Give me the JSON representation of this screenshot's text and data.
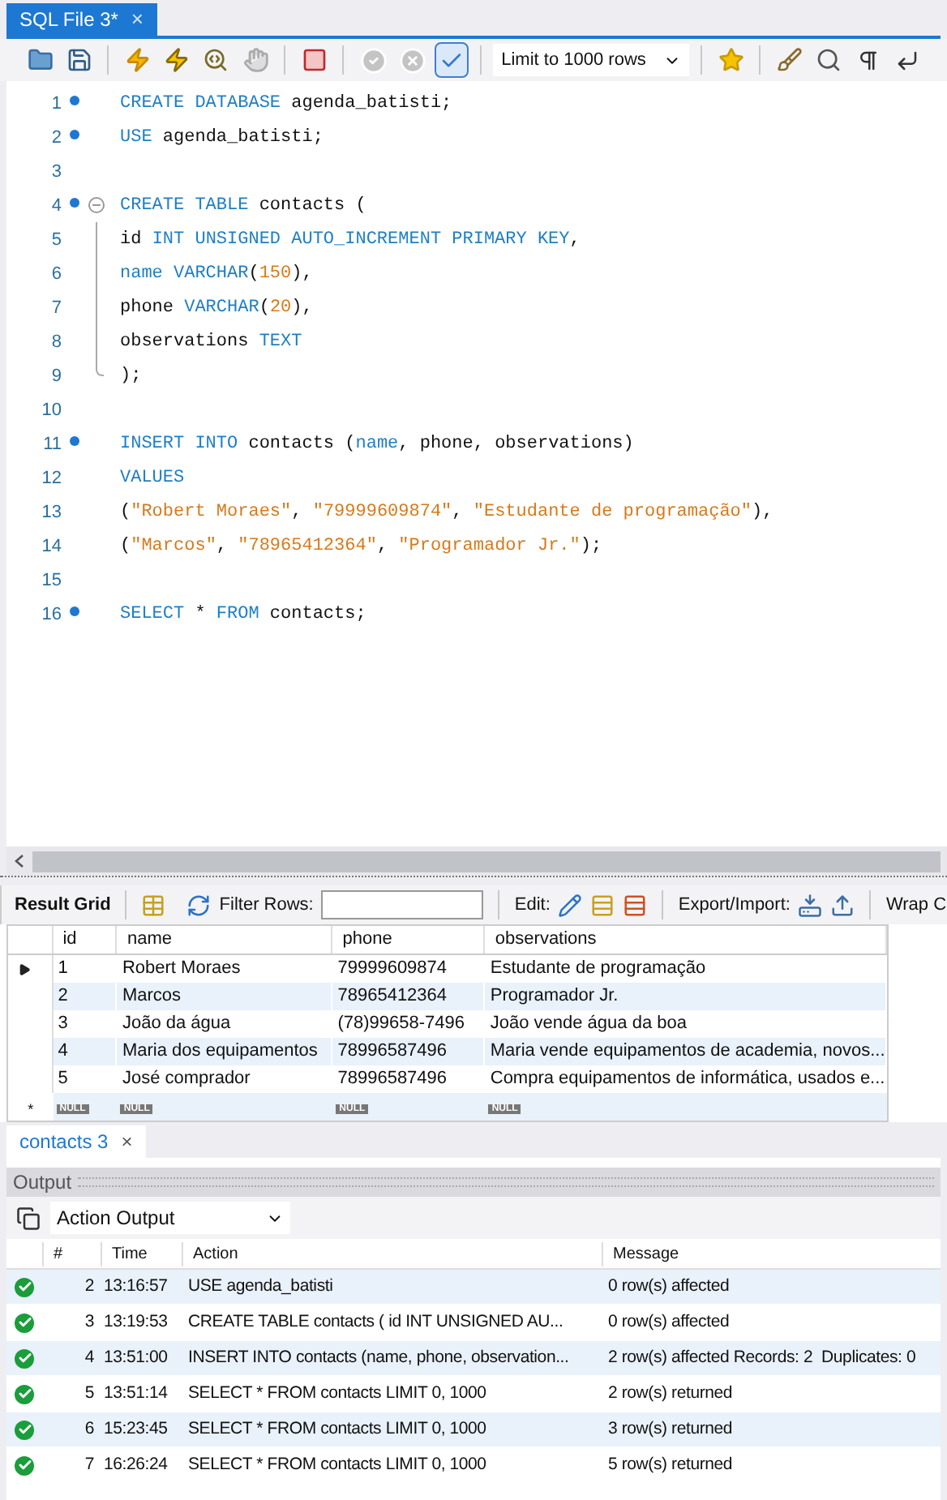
{
  "editor_tab": {
    "title": "SQL File 3*",
    "close": "×"
  },
  "toolbar": {
    "limit": "Limit to 1000 rows",
    "toggle_on": true
  },
  "code": [
    {
      "number": "1",
      "statement": true,
      "tokens": [
        {
          "kind": "kw",
          "text": "CREATE DATABASE"
        },
        {
          "kind": "plain",
          "text": " agenda_batisti;"
        }
      ]
    },
    {
      "number": "2",
      "statement": true,
      "tokens": [
        {
          "kind": "kw",
          "text": "USE"
        },
        {
          "kind": "plain",
          "text": " agenda_batisti;"
        }
      ]
    },
    {
      "number": "3",
      "statement": false
    },
    {
      "number": "4",
      "statement": true,
      "fold_start": true,
      "tokens": [
        {
          "kind": "kw",
          "text": "CREATE TABLE"
        },
        {
          "kind": "plain",
          "text": " contacts ("
        }
      ]
    },
    {
      "number": "5",
      "statement": false,
      "fold_body": true,
      "tokens": [
        {
          "kind": "plain",
          "text": "id "
        },
        {
          "kind": "kw",
          "text": "INT UNSIGNED AUTO_INCREMENT PRIMARY KEY"
        },
        {
          "kind": "plain",
          "text": ","
        }
      ]
    },
    {
      "number": "6",
      "statement": false,
      "fold_body": true,
      "tokens": [
        {
          "kind": "kw",
          "text": "name VARCHAR"
        },
        {
          "kind": "plain",
          "text": "("
        },
        {
          "kind": "lit",
          "text": "150"
        },
        {
          "kind": "plain",
          "text": "),"
        }
      ]
    },
    {
      "number": "7",
      "statement": false,
      "fold_body": true,
      "tokens": [
        {
          "kind": "plain",
          "text": "phone "
        },
        {
          "kind": "kw",
          "text": "VARCHAR"
        },
        {
          "kind": "plain",
          "text": "("
        },
        {
          "kind": "lit",
          "text": "20"
        },
        {
          "kind": "plain",
          "text": "),"
        }
      ]
    },
    {
      "number": "8",
      "statement": false,
      "fold_body": true,
      "tokens": [
        {
          "kind": "plain",
          "text": "observations "
        },
        {
          "kind": "kw",
          "text": "TEXT"
        }
      ]
    },
    {
      "number": "9",
      "statement": false,
      "fold_end": true,
      "tokens": [
        {
          "kind": "plain",
          "text": ");"
        }
      ]
    },
    {
      "number": "10",
      "statement": false
    },
    {
      "number": "11",
      "statement": true,
      "tokens": [
        {
          "kind": "kw",
          "text": "INSERT INTO"
        },
        {
          "kind": "plain",
          "text": " contacts ("
        },
        {
          "kind": "kw",
          "text": "name"
        },
        {
          "kind": "plain",
          "text": ", phone, observations)"
        }
      ]
    },
    {
      "number": "12",
      "statement": false,
      "tokens": [
        {
          "kind": "kw",
          "text": "VALUES"
        }
      ]
    },
    {
      "number": "13",
      "statement": false,
      "tokens": [
        {
          "kind": "plain",
          "text": "("
        },
        {
          "kind": "lit",
          "text": "\"Robert Moraes\""
        },
        {
          "kind": "plain",
          "text": ", "
        },
        {
          "kind": "lit",
          "text": "\"79999609874\""
        },
        {
          "kind": "plain",
          "text": ", "
        },
        {
          "kind": "lit",
          "text": "\"Estudante de programação\""
        },
        {
          "kind": "plain",
          "text": "),"
        }
      ]
    },
    {
      "number": "14",
      "statement": false,
      "tokens": [
        {
          "kind": "plain",
          "text": "("
        },
        {
          "kind": "lit",
          "text": "\"Marcos\""
        },
        {
          "kind": "plain",
          "text": ", "
        },
        {
          "kind": "lit",
          "text": "\"78965412364\""
        },
        {
          "kind": "plain",
          "text": ", "
        },
        {
          "kind": "lit",
          "text": "\"Programador Jr.\""
        },
        {
          "kind": "plain",
          "text": ");"
        }
      ]
    },
    {
      "number": "15",
      "statement": false
    },
    {
      "number": "16",
      "statement": true,
      "tokens": [
        {
          "kind": "kw",
          "text": "SELECT"
        },
        {
          "kind": "plain",
          "text": " * "
        },
        {
          "kind": "kw",
          "text": "FROM"
        },
        {
          "kind": "plain",
          "text": " contacts;"
        }
      ]
    }
  ],
  "result_toolbar": {
    "result_grid": "Result Grid",
    "filter_label": "Filter Rows:",
    "edit_label": "Edit:",
    "export_label": "Export/Import:",
    "wrap_label": "Wrap C"
  },
  "grid": {
    "columns": [
      "id",
      "name",
      "phone",
      "observations"
    ],
    "rows": [
      {
        "current": true,
        "cells": [
          "1",
          "Robert Moraes",
          "79999609874",
          "Estudante de programação"
        ]
      },
      {
        "current": false,
        "cells": [
          "2",
          "Marcos",
          "78965412364",
          "Programador Jr."
        ]
      },
      {
        "current": false,
        "cells": [
          "3",
          "João da água",
          "(78)99658-7496",
          "João vende água da boa"
        ]
      },
      {
        "current": false,
        "cells": [
          "4",
          "Maria dos equipamentos",
          "78996587496",
          "Maria vende equipamentos de academia, novos..."
        ]
      },
      {
        "current": false,
        "cells": [
          "5",
          "José comprador",
          "78996587496",
          "Compra equipamentos de informática, usados e..."
        ]
      }
    ],
    "new_row": {
      "marker": "*",
      "cells": [
        "NULL",
        "NULL",
        "NULL",
        "NULL"
      ]
    }
  },
  "result_tab": {
    "title": "contacts 3",
    "close": "×"
  },
  "output": {
    "title": "Output",
    "selector": "Action Output",
    "columns": [
      "#",
      "Time",
      "Action",
      "Message"
    ],
    "rows": [
      {
        "success": true,
        "number": "2",
        "time": "13:16:57",
        "action": "USE agenda_batisti",
        "message": "0 row(s) affected"
      },
      {
        "success": true,
        "number": "3",
        "time": "13:19:53",
        "action": "CREATE TABLE contacts ( id INT UNSIGNED AU...",
        "message": "0 row(s) affected"
      },
      {
        "success": true,
        "number": "4",
        "time": "13:51:00",
        "action": "INSERT INTO contacts (name, phone, observation...",
        "message": "2 row(s) affected Records: 2  Duplicates: 0"
      },
      {
        "success": true,
        "number": "5",
        "time": "13:51:14",
        "action": "SELECT * FROM contacts LIMIT 0, 1000",
        "message": "2 row(s) returned"
      },
      {
        "success": true,
        "number": "6",
        "time": "15:23:45",
        "action": "SELECT * FROM contacts LIMIT 0, 1000",
        "message": "3 row(s) returned"
      },
      {
        "success": true,
        "number": "7",
        "time": "16:26:24",
        "action": "SELECT * FROM contacts LIMIT 0, 1000",
        "message": "5 row(s) returned"
      }
    ]
  }
}
